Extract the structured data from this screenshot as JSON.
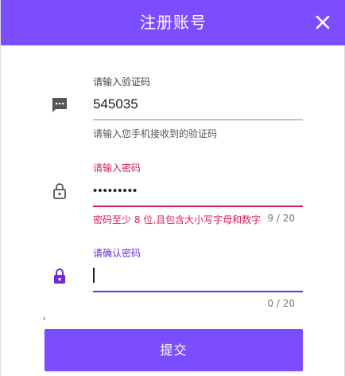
{
  "header": {
    "title": "注册账号"
  },
  "colors": {
    "accent": "#7c4dff",
    "error": "#d81b60",
    "focused": "#6f2dd6"
  },
  "icons": {
    "code": "sms-icon",
    "password": "lock-outline-icon",
    "confirm": "lock-filled-icon",
    "close": "close-icon"
  },
  "form": {
    "verification": {
      "label": "请输入验证码",
      "value": "545035",
      "helper": "请输入您手机接收到的验证码"
    },
    "password": {
      "label": "请输入密码",
      "value": "•••••••••",
      "error": "密码至少 8 位,且包含大小写字母和数字",
      "counter": "9 / 20"
    },
    "confirm": {
      "label": "请确认密码",
      "value": "",
      "counter": "0 / 20"
    },
    "submit_label": "提交"
  }
}
